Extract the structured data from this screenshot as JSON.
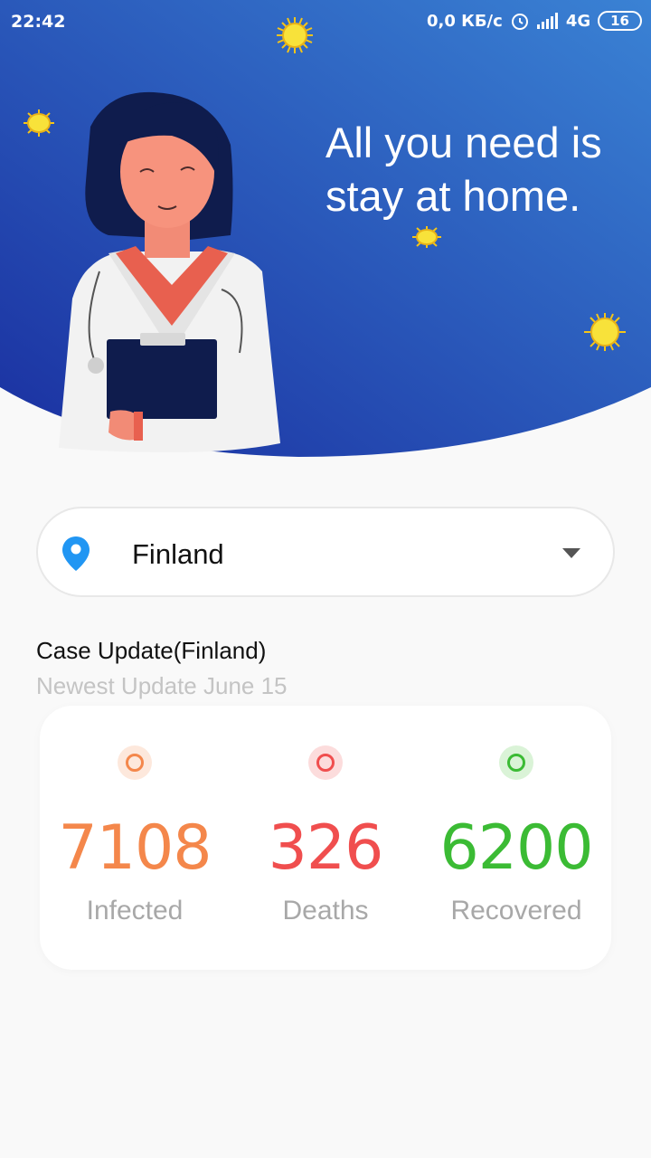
{
  "status_bar": {
    "time": "22:42",
    "network_speed": "0,0 КБ/с",
    "network_type": "4G",
    "battery": "16",
    "icons": [
      "sun-icon",
      "alarm-icon",
      "signal-icon",
      "battery-icon"
    ]
  },
  "header": {
    "headline": "All you need is stay at home."
  },
  "country_selector": {
    "selected": "Finland",
    "icon": "location-pin-icon"
  },
  "case_update": {
    "title": "Case Update(Finland)",
    "subtitle": "Newest Update June 15"
  },
  "stats": [
    {
      "value": "7108",
      "label": "Infected",
      "color": "#f4874b",
      "dot_bg": "#fde8dc"
    },
    {
      "value": "326",
      "label": "Deaths",
      "color": "#f04e4e",
      "dot_bg": "#fcdcdc"
    },
    {
      "value": "6200",
      "label": "Recovered",
      "color": "#3bbb34",
      "dot_bg": "#daf3d7"
    }
  ],
  "colors": {
    "header_gradient_start": "#1a3aa8",
    "header_gradient_end": "#3a86d6",
    "background": "#f9f9f9"
  }
}
